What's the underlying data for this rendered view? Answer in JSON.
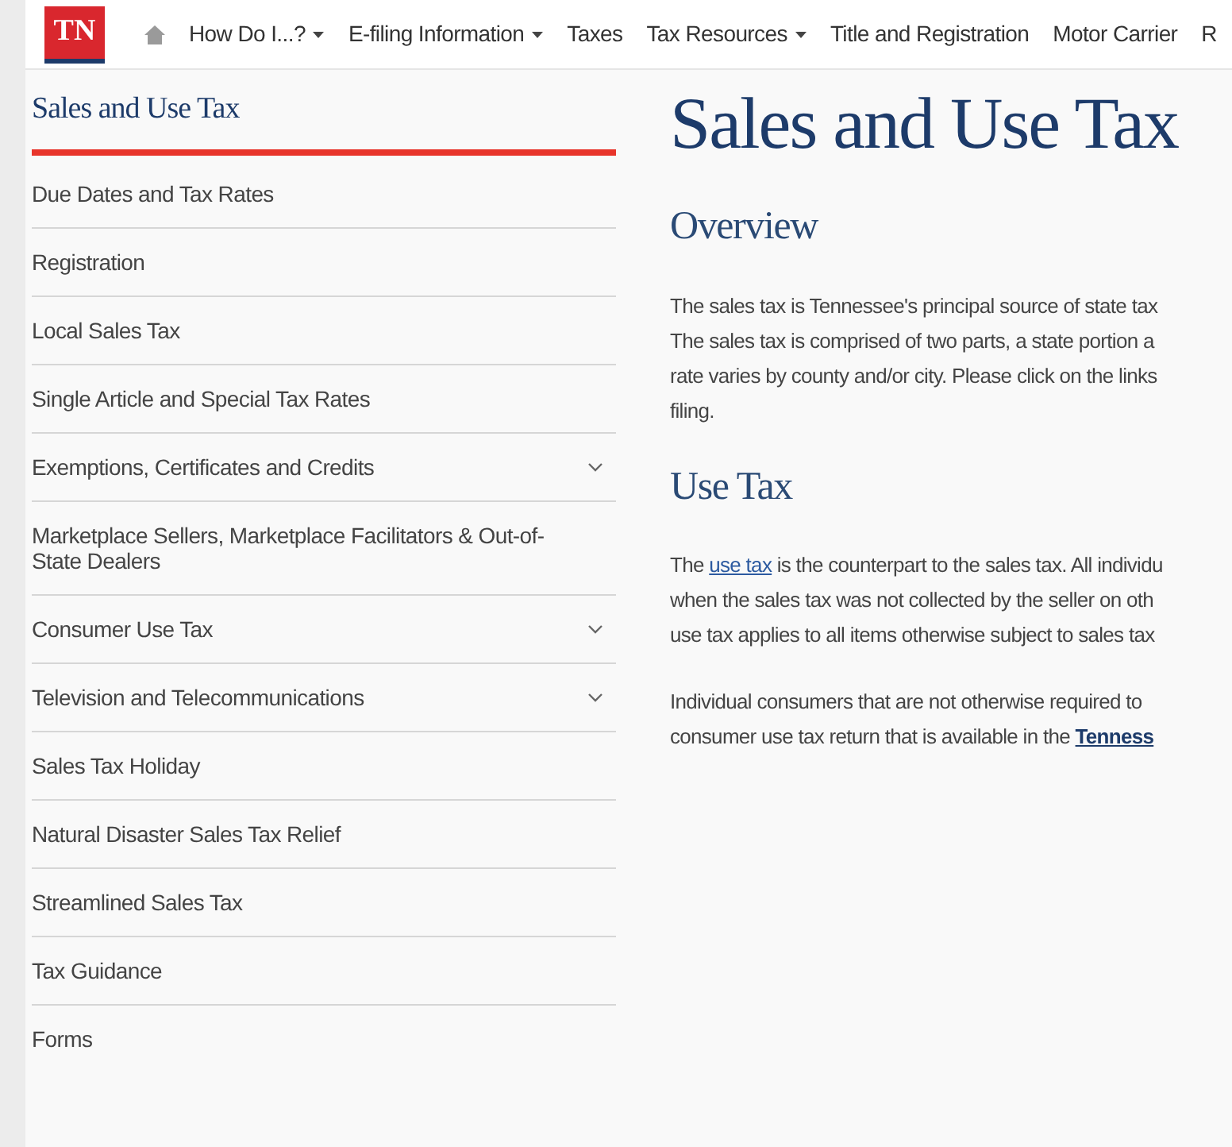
{
  "nav": {
    "logo": "TN",
    "items": [
      {
        "label": "How Do I...?",
        "dropdown": true
      },
      {
        "label": "E-filing Information",
        "dropdown": true
      },
      {
        "label": "Taxes",
        "dropdown": false
      },
      {
        "label": "Tax Resources",
        "dropdown": true
      },
      {
        "label": "Title and Registration",
        "dropdown": false
      },
      {
        "label": "Motor Carrier",
        "dropdown": false
      },
      {
        "label": "R",
        "dropdown": false
      }
    ]
  },
  "sidebar": {
    "title": "Sales and Use Tax",
    "items": [
      {
        "label": "Due Dates and Tax Rates",
        "expandable": false
      },
      {
        "label": "Registration",
        "expandable": false
      },
      {
        "label": "Local Sales Tax",
        "expandable": false
      },
      {
        "label": "Single Article and Special Tax Rates",
        "expandable": false
      },
      {
        "label": "Exemptions, Certificates and Credits",
        "expandable": true
      },
      {
        "label": "Marketplace Sellers, Marketplace Facilitators & Out-of-State Dealers",
        "expandable": false
      },
      {
        "label": "Consumer Use Tax",
        "expandable": true
      },
      {
        "label": "Television and Telecommunications",
        "expandable": true
      },
      {
        "label": "Sales Tax Holiday",
        "expandable": false
      },
      {
        "label": "Natural Disaster Sales Tax Relief",
        "expandable": false
      },
      {
        "label": "Streamlined Sales Tax",
        "expandable": false
      },
      {
        "label": "Tax Guidance",
        "expandable": false
      },
      {
        "label": "Forms",
        "expandable": false
      }
    ]
  },
  "main": {
    "title": "Sales and Use Tax",
    "sections": [
      {
        "heading": "Overview",
        "paragraphs": [
          [
            [
              {
                "text": "The sales tax is Tennessee's principal source of state tax"
              }
            ],
            [
              {
                "text": "The sales tax is comprised of two parts, a state portion a"
              }
            ],
            [
              {
                "text": "rate varies by county and/or city. Please click on the links"
              }
            ],
            [
              {
                "text": "filing."
              }
            ]
          ]
        ]
      },
      {
        "heading": "Use Tax",
        "paragraphs": [
          [
            [
              {
                "text": "The "
              },
              {
                "text": "use tax",
                "kind": "link"
              },
              {
                "text": " is the counterpart to the sales tax. All individu"
              }
            ],
            [
              {
                "text": "when the sales tax was not collected by the seller on oth"
              }
            ],
            [
              {
                "text": "use tax applies to all items otherwise subject to sales tax"
              }
            ]
          ],
          [
            [
              {
                "text": "Individual consumers that are not otherwise required to"
              }
            ],
            [
              {
                "text": "consumer use tax return that is  available in the "
              },
              {
                "text": "Tenness",
                "kind": "bold-link"
              }
            ]
          ]
        ]
      }
    ]
  }
}
